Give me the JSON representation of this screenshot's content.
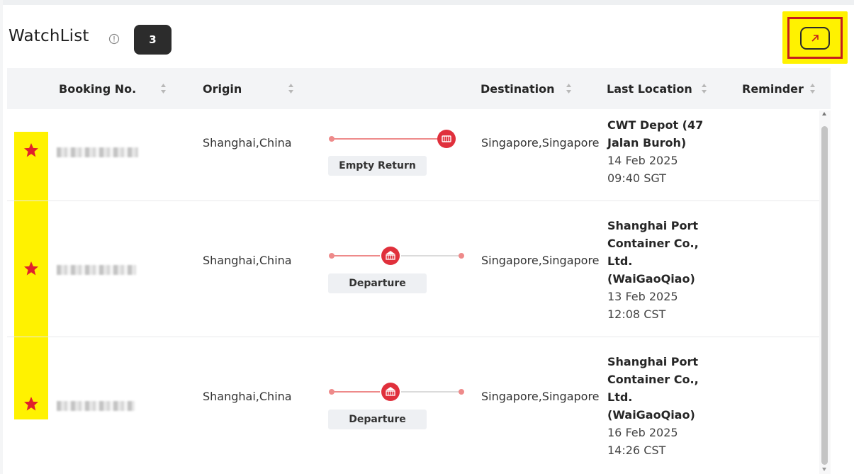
{
  "header": {
    "title": "WatchList",
    "count": "3",
    "info_icon": "info-circle-icon",
    "expand_icon": "external-link-arrow-icon"
  },
  "table": {
    "columns": {
      "booking_no": "Booking No.",
      "origin": "Origin",
      "destination": "Destination",
      "last_location": "Last Location",
      "reminder": "Reminder"
    },
    "rows": [
      {
        "starred": true,
        "origin": "Shanghai,China",
        "destination": "Singapore,Singapore",
        "status": "Empty Return",
        "progress_stage": "end",
        "last_location": "CWT Depot (47 Jalan Buroh)",
        "date": "14 Feb 2025",
        "time": "09:40 SGT",
        "reminder": ""
      },
      {
        "starred": true,
        "origin": "Shanghai,China",
        "destination": "Singapore,Singapore",
        "status": "Departure",
        "progress_stage": "middle",
        "last_location": "Shanghai Port Container Co., Ltd. (WaiGaoQiao)",
        "date": "13 Feb 2025",
        "time": "12:08 CST",
        "reminder": ""
      },
      {
        "starred": true,
        "origin": "Shanghai,China",
        "destination": "Singapore,Singapore",
        "status": "Departure",
        "progress_stage": "middle",
        "last_location": "Shanghai Port Container Co., Ltd. (WaiGaoQiao)",
        "date": "16 Feb 2025",
        "time": "14:26 CST",
        "reminder": ""
      }
    ]
  },
  "colors": {
    "accent_red": "#e0303c",
    "highlight_yellow": "#fff200",
    "badge_dark": "#2c2c2c"
  }
}
